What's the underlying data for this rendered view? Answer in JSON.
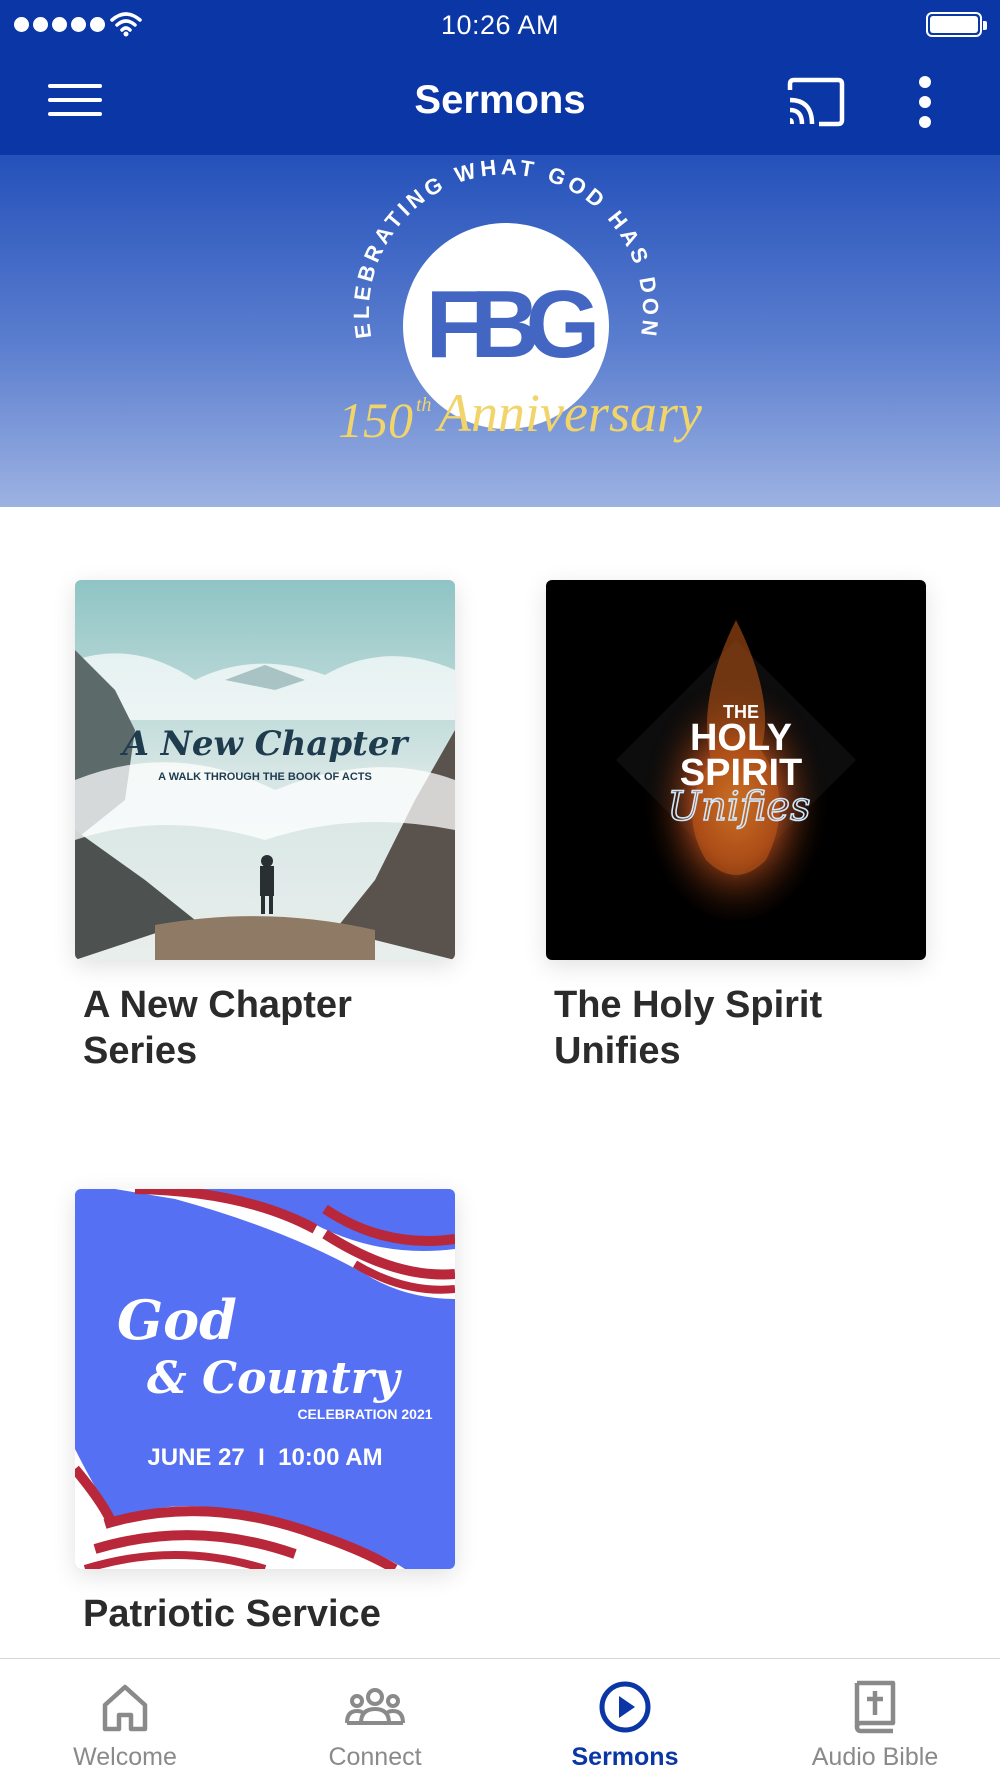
{
  "status_bar": {
    "time": "10:26 AM"
  },
  "app_bar": {
    "title": "Sermons"
  },
  "banner": {
    "arc_text": "CELEBRATING WHAT GOD HAS DONE",
    "monogram": "FBG",
    "anniversary_number": "150",
    "anniversary_suffix": "th",
    "anniversary_word": "Anniversary"
  },
  "series": [
    {
      "title": "A New Chapter Series",
      "art": {
        "headline": "A New Chapter",
        "subline": "A WALK THROUGH THE BOOK OF ACTS"
      }
    },
    {
      "title": "The Holy Spirit Unifies",
      "art": {
        "line1": "THE",
        "line2": "HOLY",
        "line3": "SPIRIT",
        "line4": "Unifies"
      }
    },
    {
      "title": "Patriotic Service",
      "art": {
        "line1": "God",
        "line2": "& Country",
        "line3": "CELEBRATION 2021",
        "line4": "JUNE 27  I  10:00 AM"
      }
    }
  ],
  "tabs": [
    {
      "label": "Welcome",
      "icon": "home-icon",
      "active": false
    },
    {
      "label": "Connect",
      "icon": "people-icon",
      "active": false
    },
    {
      "label": "Sermons",
      "icon": "play-circle-icon",
      "active": true
    },
    {
      "label": "Audio Bible",
      "icon": "bible-icon",
      "active": false
    }
  ],
  "colors": {
    "primary": "#0b36a6",
    "active_tab": "#0b36a6",
    "inactive_tab": "#8a8a8a",
    "anniversary_gold": "#f1d46a",
    "patriotic_blue": "#5570f3"
  }
}
